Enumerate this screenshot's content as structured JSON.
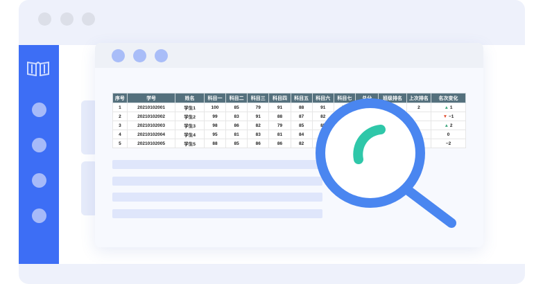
{
  "window": {
    "traffic_dots": 3
  },
  "sidebar": {
    "logo_icon": "book-icon",
    "items": 4
  },
  "table": {
    "headers": [
      "序号",
      "学号",
      "姓名",
      "科目一",
      "科目二",
      "科目三",
      "科目四",
      "科目五",
      "科目六",
      "科目七",
      "总分",
      "班级排名",
      "上次排名",
      "名次变化"
    ],
    "rows": [
      [
        "1",
        "20210102001",
        "学生1",
        "100",
        "85",
        "79",
        "91",
        "88",
        "91",
        "79",
        "",
        "",
        "2",
        "1"
      ],
      [
        "2",
        "20210102002",
        "学生2",
        "99",
        "83",
        "91",
        "88",
        "87",
        "82",
        "",
        "",
        "",
        "",
        "−1"
      ],
      [
        "3",
        "20210102003",
        "学生3",
        "98",
        "86",
        "82",
        "79",
        "85",
        "85",
        "",
        "",
        "",
        "",
        "2"
      ],
      [
        "4",
        "20210102004",
        "学生4",
        "95",
        "81",
        "83",
        "81",
        "84",
        "79",
        "",
        "",
        "",
        "",
        "0"
      ],
      [
        "5",
        "20210102005",
        "学生5",
        "88",
        "85",
        "86",
        "86",
        "82",
        "8",
        "",
        "",
        "",
        "",
        "−2"
      ]
    ],
    "trend_arrows": [
      "up",
      "down",
      "up",
      "",
      ""
    ]
  },
  "colors": {
    "sidebar": "#3d6ef5",
    "table_header": "#54707d",
    "magnifier_ring": "#4a86f0",
    "magnifier_accent": "#2fc7a9",
    "arrow_up": "#3aa47a",
    "arrow_down": "#e0492a"
  }
}
